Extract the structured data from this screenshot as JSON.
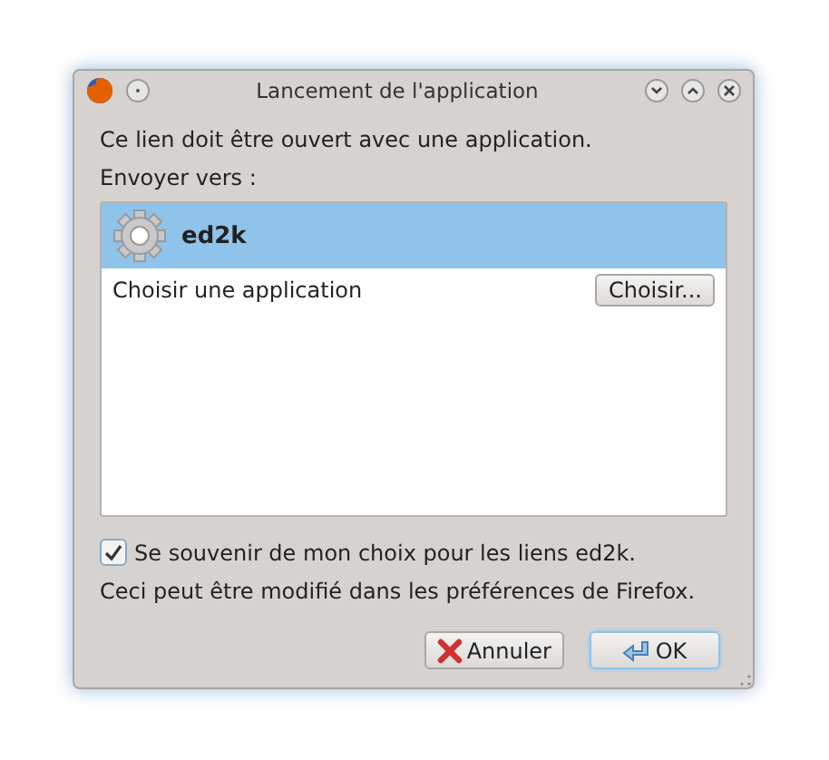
{
  "window": {
    "title": "Lancement de l'application"
  },
  "message": "Ce lien doit être ouvert avec une application.",
  "send_to_label": "Envoyer vers :",
  "apps": [
    {
      "kind": "app",
      "name": "ed2k",
      "selected": true
    },
    {
      "kind": "chooser",
      "name": "Choisir une application",
      "button": "Choisir...",
      "selected": false
    }
  ],
  "remember": {
    "label": "Se souvenir de mon choix pour les liens ed2k.",
    "checked": true
  },
  "note": "Ceci peut être modifié dans les préférences de Firefox.",
  "buttons": [
    {
      "kind": "cancel",
      "label": "Annuler",
      "focused": false
    },
    {
      "kind": "ok",
      "label": "OK",
      "focused": true
    }
  ]
}
